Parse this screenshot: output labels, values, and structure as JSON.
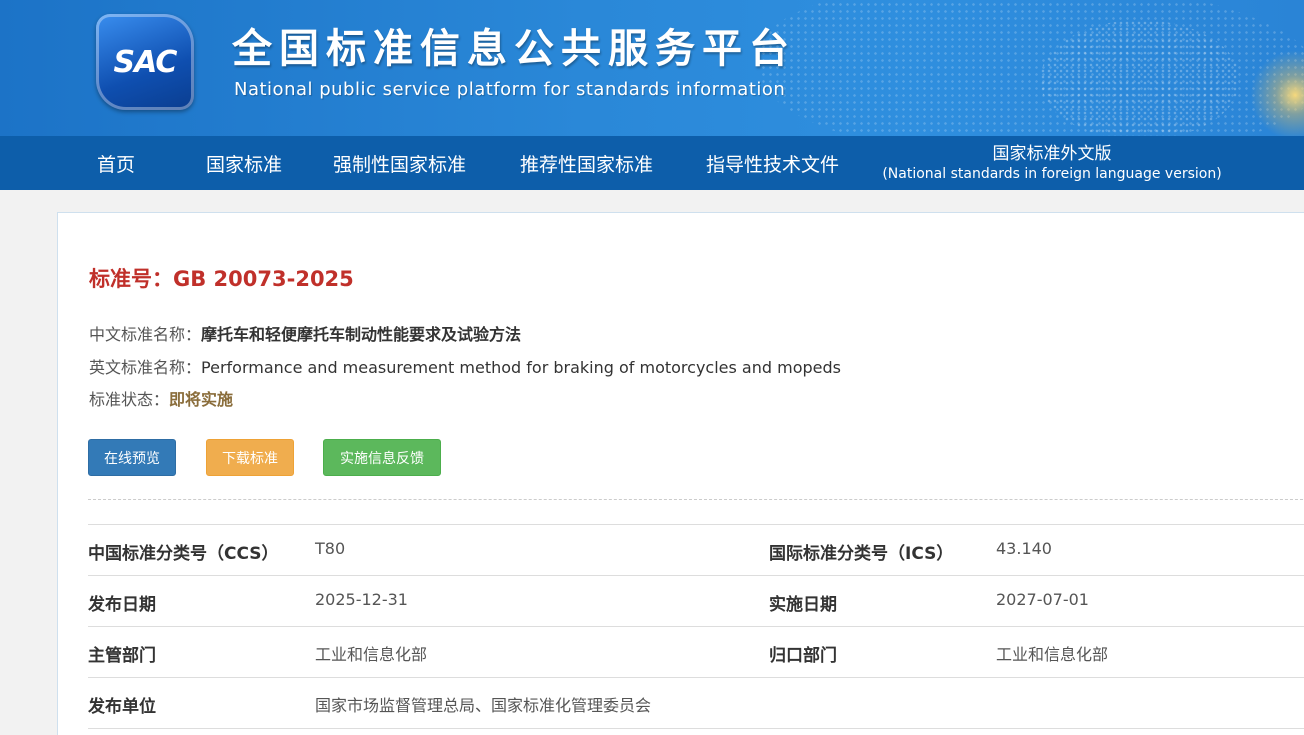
{
  "header": {
    "logo_text": "SAC",
    "title": "全国标准信息公共服务平台",
    "subtitle": "National public service platform  for standards information"
  },
  "nav": {
    "items": [
      {
        "label": "首页"
      },
      {
        "label": "国家标准"
      },
      {
        "label": "强制性国家标准"
      },
      {
        "label": "推荐性国家标准"
      },
      {
        "label": "指导性技术文件"
      }
    ],
    "foreign": {
      "label": "国家标准外文版",
      "sublabel": "(National standards in foreign language version)"
    }
  },
  "standard": {
    "number_label": "标准号：",
    "number": "GB 20073-2025",
    "cn_name_label": "中文标准名称：",
    "cn_name": "摩托车和轻便摩托车制动性能要求及试验方法",
    "en_name_label": "英文标准名称：",
    "en_name": "Performance and measurement method for braking of motorcycles and mopeds",
    "status_label": "标准状态：",
    "status": "即将实施"
  },
  "buttons": {
    "preview": "在线预览",
    "download": "下载标准",
    "feedback": "实施信息反馈"
  },
  "details": {
    "ccs_label": "中国标准分类号（CCS）",
    "ccs": "T80",
    "ics_label": "国际标准分类号（ICS）",
    "ics": "43.140",
    "publish_date_label": "发布日期",
    "publish_date": "2025-12-31",
    "implement_date_label": "实施日期",
    "implement_date": "2027-07-01",
    "authority_label": "主管部门",
    "authority": "工业和信息化部",
    "centralized_label": "归口部门",
    "centralized": "工业和信息化部",
    "issuer_label": "发布单位",
    "issuer": "国家市场监督管理总局、国家标准化管理委员会"
  },
  "colors": {
    "banner": "#2a88d8",
    "nav": "#0d5eaa",
    "std_number": "#c0302a",
    "status": "#8a6d3b",
    "btn_preview": "#337ab7",
    "btn_download": "#f0ad4e",
    "btn_feedback": "#5cb85c"
  }
}
